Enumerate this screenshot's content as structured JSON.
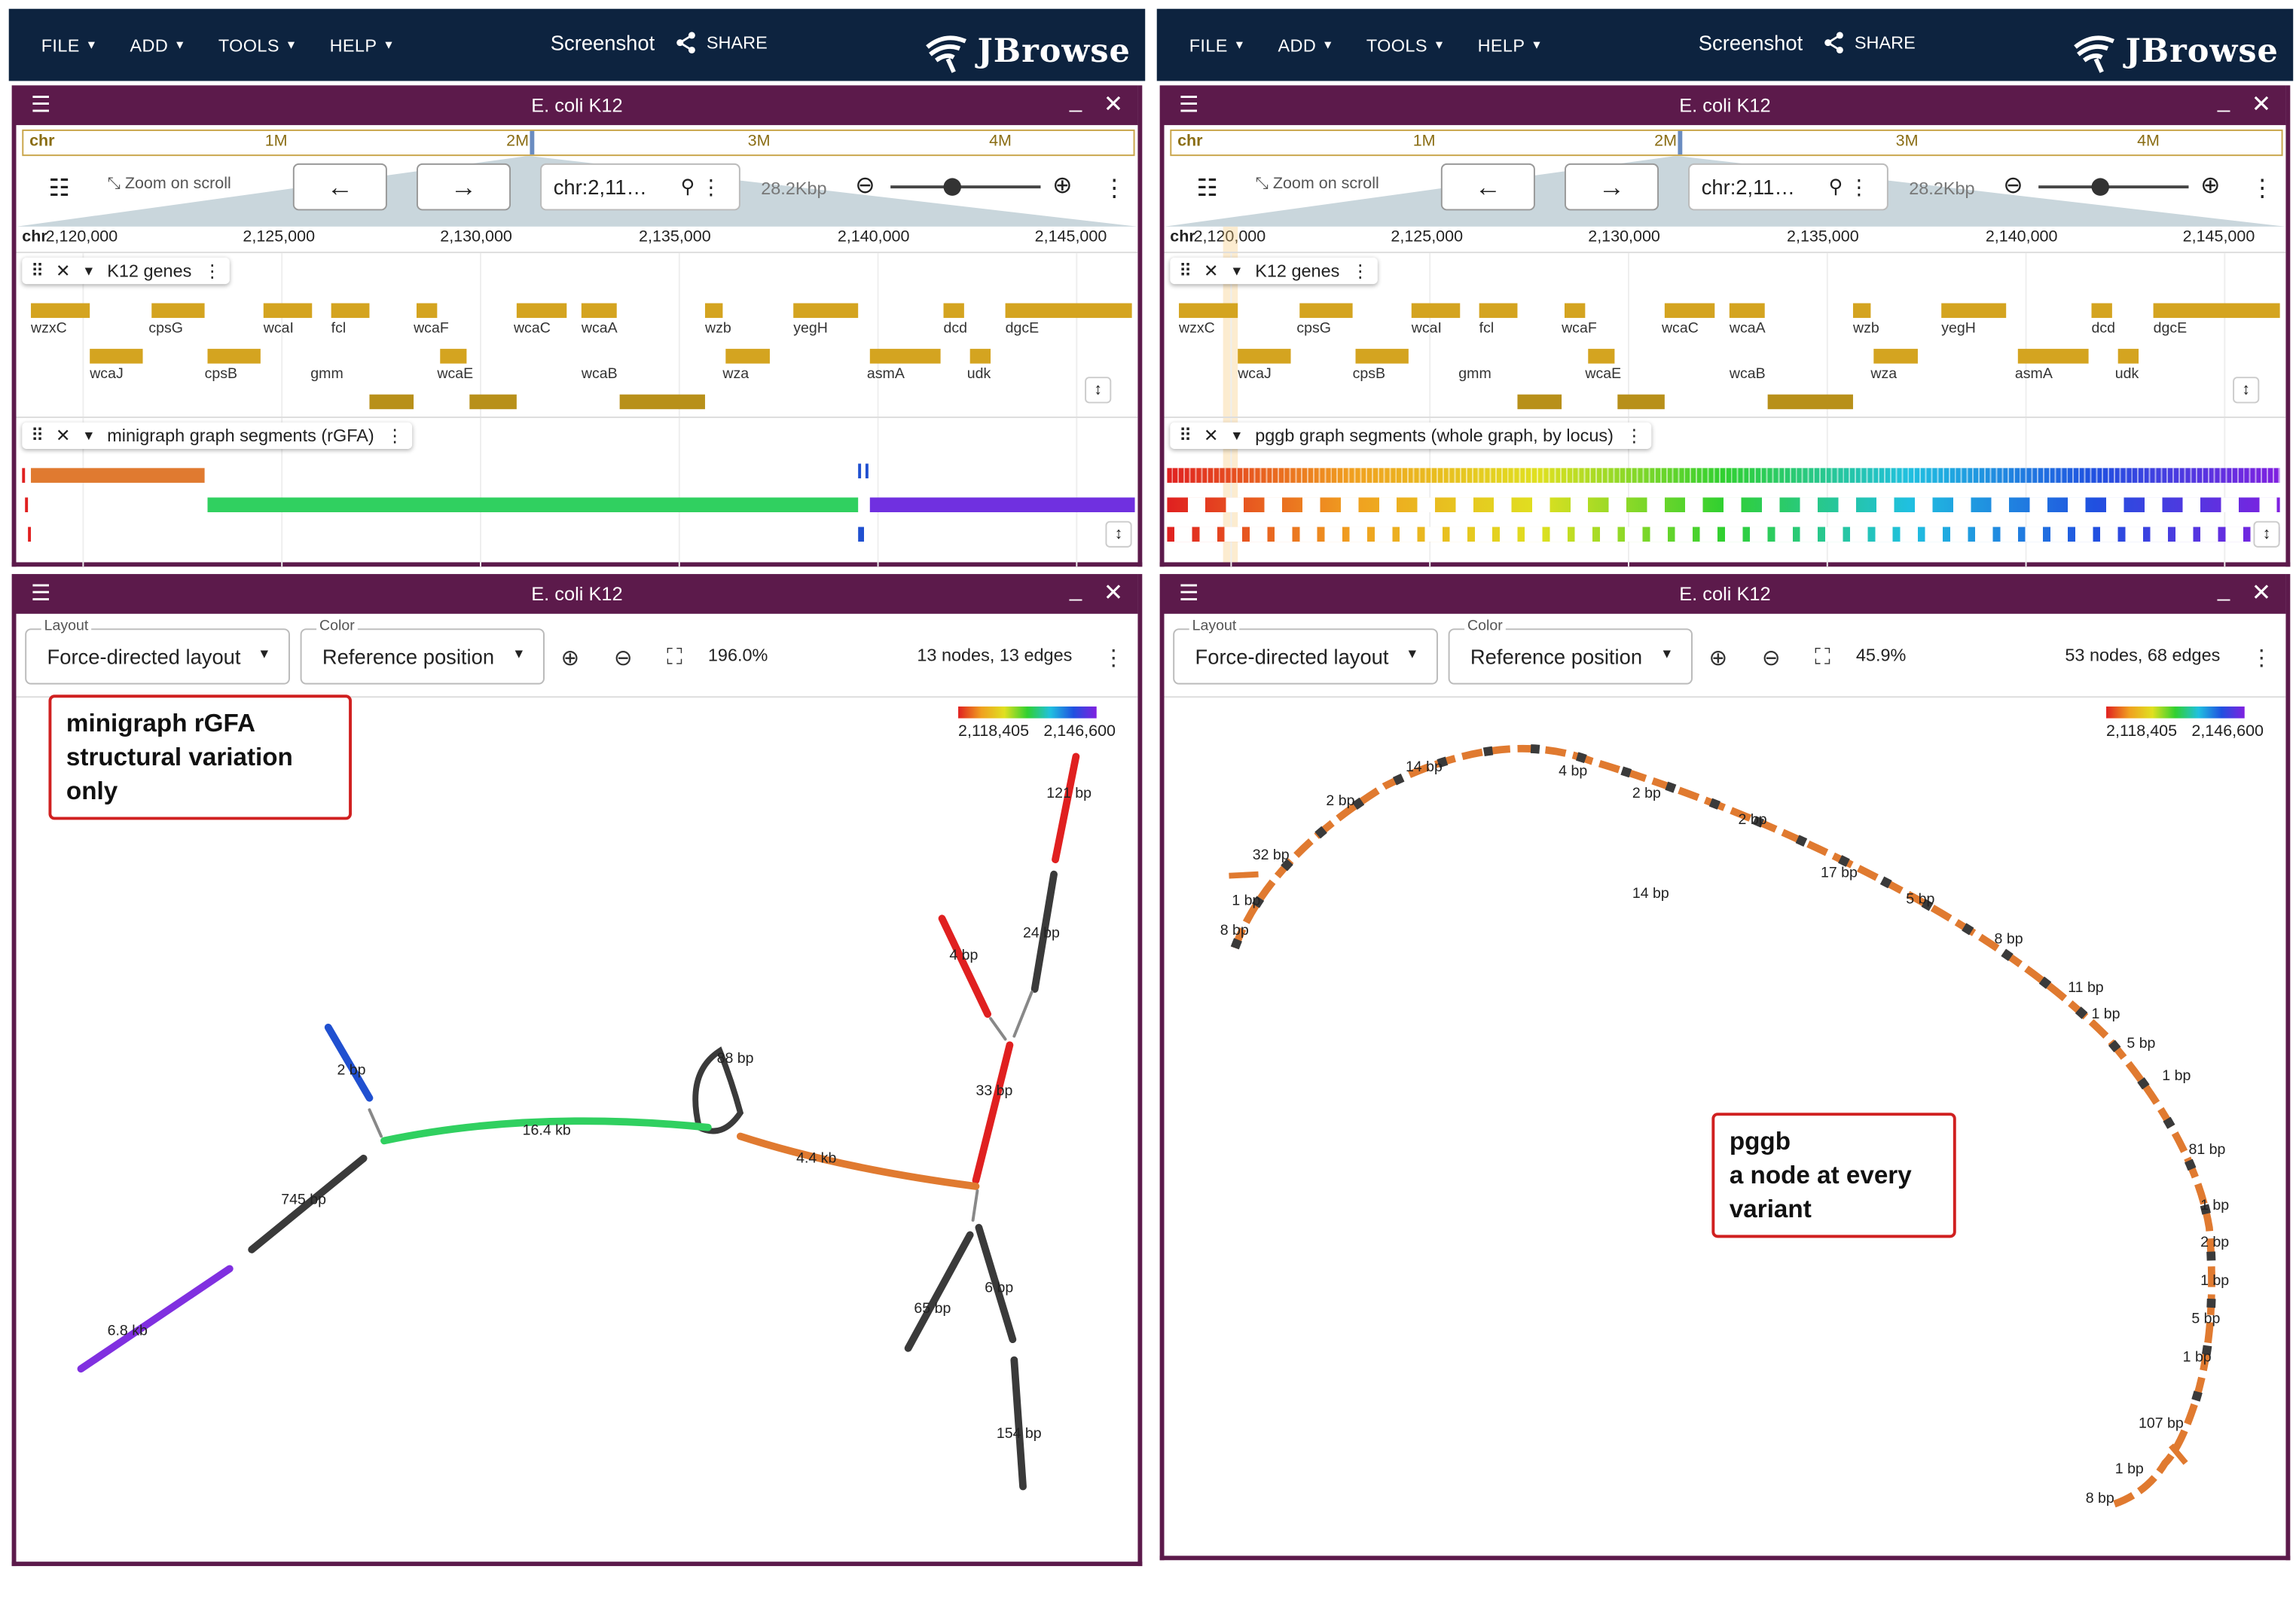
{
  "appbar": {
    "menu": [
      "FILE",
      "ADD",
      "TOOLS",
      "HELP"
    ],
    "screenshot_label": "Screenshot",
    "share_label": "SHARE",
    "logo_text": "JBrowse"
  },
  "panels": [
    {
      "linear_view": {
        "title": "E. coli K12",
        "overview_labels": [
          "chr",
          "1M",
          "2M",
          "3M",
          "4M"
        ],
        "zoom_on_scroll": "Zoom on scroll",
        "location": "chr:2,11…",
        "bp_per_px": "28.2Kbp",
        "ruler_chr": "chr",
        "ruler_ticks": [
          "2,120,000",
          "2,125,000",
          "2,130,000",
          "2,135,000",
          "2,140,000",
          "2,145,000"
        ],
        "gene_track": {
          "label": "K12 genes",
          "genes_row1": [
            "wzxC",
            "cpsG",
            "wcaI",
            "fcl",
            "wcaF",
            "wcaC",
            "wcaA",
            "wzb",
            "yegH",
            "dcd",
            "dgcE"
          ],
          "genes_row2": [
            "wcaJ",
            "cpsB",
            "gmm",
            "wcaE",
            "wcaB",
            "wza",
            "asmA",
            "udk"
          ]
        },
        "graph_track": {
          "label": "minigraph graph segments (rGFA)"
        }
      },
      "graph_view": {
        "title": "E. coli K12",
        "layout_caption": "Layout",
        "layout_value": "Force-directed layout",
        "color_caption": "Color",
        "color_value": "Reference position",
        "zoom": "196.0%",
        "stats": "13 nodes, 13 edges",
        "legend_min": "2,118,405",
        "legend_max": "2,146,600",
        "annotation": [
          "minigraph rGFA",
          "structural variation",
          "only"
        ],
        "node_labels": [
          "121 bp",
          "24 bp",
          "4 bp",
          "33 bp",
          "88 bp",
          "2 bp",
          "16.4 kb",
          "4.4 kb",
          "745 bp",
          "6.8 kb",
          "6 bp",
          "65 bp",
          "154 bp"
        ]
      }
    },
    {
      "linear_view": {
        "title": "E. coli K12",
        "overview_labels": [
          "chr",
          "1M",
          "2M",
          "3M",
          "4M"
        ],
        "zoom_on_scroll": "Zoom on scroll",
        "location": "chr:2,11…",
        "bp_per_px": "28.2Kbp",
        "ruler_chr": "chr",
        "ruler_ticks": [
          "2,120,000",
          "2,125,000",
          "2,130,000",
          "2,135,000",
          "2,140,000",
          "2,145,000"
        ],
        "gene_track": {
          "label": "K12 genes",
          "genes_row1": [
            "wzxC",
            "cpsG",
            "wcaI",
            "fcl",
            "wcaF",
            "wcaC",
            "wcaA",
            "wzb",
            "yegH",
            "dcd",
            "dgcE"
          ],
          "genes_row2": [
            "wcaJ",
            "cpsB",
            "gmm",
            "wcaE",
            "wcaB",
            "wza",
            "asmA",
            "udk"
          ]
        },
        "graph_track": {
          "label": "pggb graph segments (whole graph, by locus)"
        }
      },
      "graph_view": {
        "title": "E. coli K12",
        "layout_caption": "Layout",
        "layout_value": "Force-directed layout",
        "color_caption": "Color",
        "color_value": "Reference position",
        "zoom": "45.9%",
        "stats": "53 nodes, 68 edges",
        "legend_min": "2,118,405",
        "legend_max": "2,146,600",
        "annotation": [
          "pggb",
          "a node at every",
          "variant"
        ],
        "node_labels": [
          "14 bp",
          "2 bp",
          "4 bp",
          "2 bp",
          "14 bp",
          "2 bp",
          "32 bp",
          "17 bp",
          "1 bp",
          "5 bp",
          "8 bp",
          "8 bp",
          "11 bp",
          "1 bp",
          "5 bp",
          "1 bp",
          "81 bp",
          "1 bp",
          "2 bp",
          "1 bp",
          "5 bp",
          "1 bp",
          "107 bp",
          "1 bp",
          "8 bp"
        ]
      }
    }
  ],
  "colors": {
    "appbar": "#0d233f",
    "view_header": "#5c1a4b",
    "gene": "#d4a420",
    "graph_node_dark": "#3a3a3a",
    "annotation_border": "#d02020"
  }
}
